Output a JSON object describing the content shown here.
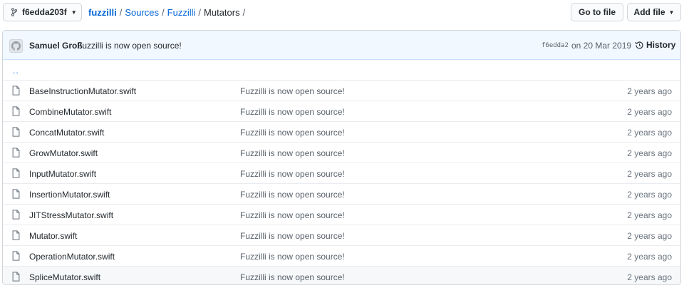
{
  "toolbar": {
    "branch": "f6edda203f",
    "goto_file": "Go to file",
    "add_file": "Add file",
    "branch_icon": "git-branch-icon"
  },
  "breadcrumb": {
    "repo": "fuzzilli",
    "parts": [
      "Sources",
      "Fuzzilli"
    ],
    "current": "Mutators",
    "sep": "/"
  },
  "commit": {
    "author": "Samuel Groß",
    "message": "Fuzzilli is now open source!",
    "sha": "f6edda2",
    "date": "on 20 Mar 2019",
    "history": "History"
  },
  "up_dir": "..",
  "files": [
    {
      "name": "BaseInstructionMutator.swift",
      "message": "Fuzzilli is now open source!",
      "age": "2 years ago"
    },
    {
      "name": "CombineMutator.swift",
      "message": "Fuzzilli is now open source!",
      "age": "2 years ago"
    },
    {
      "name": "ConcatMutator.swift",
      "message": "Fuzzilli is now open source!",
      "age": "2 years ago"
    },
    {
      "name": "GrowMutator.swift",
      "message": "Fuzzilli is now open source!",
      "age": "2 years ago"
    },
    {
      "name": "InputMutator.swift",
      "message": "Fuzzilli is now open source!",
      "age": "2 years ago"
    },
    {
      "name": "InsertionMutator.swift",
      "message": "Fuzzilli is now open source!",
      "age": "2 years ago"
    },
    {
      "name": "JITStressMutator.swift",
      "message": "Fuzzilli is now open source!",
      "age": "2 years ago"
    },
    {
      "name": "Mutator.swift",
      "message": "Fuzzilli is now open source!",
      "age": "2 years ago"
    },
    {
      "name": "OperationMutator.swift",
      "message": "Fuzzilli is now open source!",
      "age": "2 years ago"
    },
    {
      "name": "SpliceMutator.swift",
      "message": "Fuzzilli is now open source!",
      "age": "2 years ago"
    }
  ],
  "colors": {
    "link": "#0366d6",
    "commit_bg": "#f1f8ff",
    "border": "#d1d5da"
  }
}
